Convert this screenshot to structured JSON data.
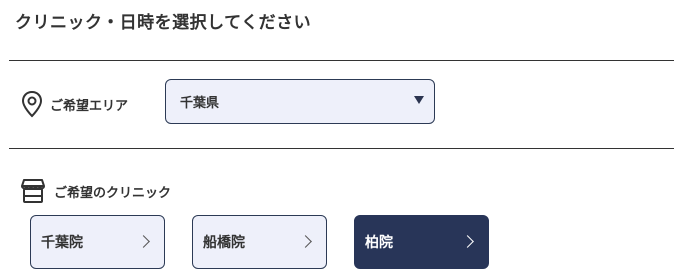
{
  "page": {
    "title": "クリニック・日時を選択してください"
  },
  "area": {
    "label": "ご希望エリア",
    "icon": "location-pin-icon",
    "selected": "千葉県"
  },
  "clinic": {
    "label": "ご希望のクリニック",
    "icon": "storefront-icon",
    "options": [
      {
        "label": "千葉院",
        "selected": false
      },
      {
        "label": "船橋院",
        "selected": false
      },
      {
        "label": "柏院",
        "selected": true
      }
    ]
  },
  "colors": {
    "accent": "#283558",
    "button_bg": "#eef0fa",
    "text": "#333333"
  }
}
